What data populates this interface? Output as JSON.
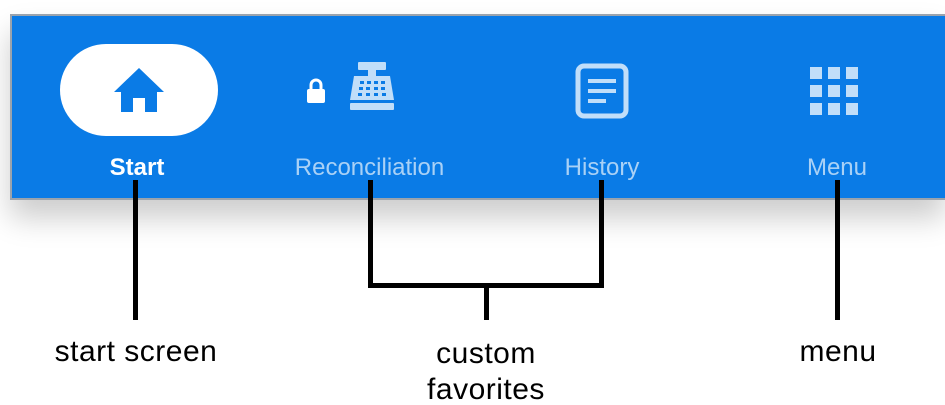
{
  "nav": {
    "items": [
      {
        "label": "Start",
        "icon": "home-icon",
        "active": true
      },
      {
        "label": "Reconciliation",
        "icon": "cash-register-icon",
        "locked": true
      },
      {
        "label": "History",
        "icon": "history-icon"
      },
      {
        "label": "Menu",
        "icon": "grid-menu-icon"
      }
    ]
  },
  "callouts": {
    "start": "start screen",
    "favorites_line1": "custom",
    "favorites_line2": "favorites",
    "menu": "menu"
  },
  "colors": {
    "bar": "#0a7be6",
    "active_pill": "#ffffff",
    "inactive_label": "rgba(255,255,255,0.65)"
  }
}
